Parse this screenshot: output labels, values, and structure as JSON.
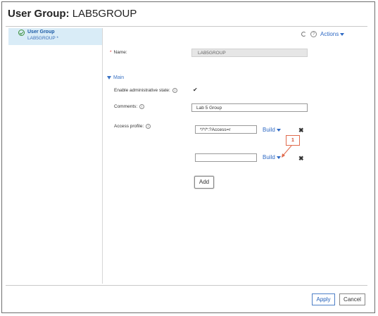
{
  "header": {
    "title_prefix": "User Group:",
    "title_name": "LAB5GROUP"
  },
  "sidebar": {
    "items": [
      {
        "label": "User Group",
        "sublabel": "LAB5GROUP *"
      }
    ]
  },
  "toolbar": {
    "actions_label": "Actions",
    "help_glyph": "?",
    "refresh_icon": "refresh-icon"
  },
  "form": {
    "name_label": "Name:",
    "name_value": "LAB5GROUP",
    "section_label": "Main",
    "enable_admin_label": "Enable administrative state:",
    "enable_admin_checked": "✔",
    "comments_label": "Comments:",
    "comments_value": "Lab 5 Group",
    "access_profile_label": "Access profile:",
    "access_profiles": [
      {
        "value": "*/*/*:?Access=r",
        "build_label": "Build"
      },
      {
        "value": "",
        "build_label": "Build"
      }
    ],
    "add_label": "Add",
    "info_glyph": "i",
    "remove_glyph": "✖"
  },
  "annotation": {
    "callout_number": "1",
    "color": "#e06a4c"
  },
  "footer": {
    "apply_label": "Apply",
    "cancel_label": "Cancel"
  },
  "colors": {
    "link": "#2e69c4",
    "sidebar_selected": "#d9ecf7",
    "required": "#dd3333"
  }
}
